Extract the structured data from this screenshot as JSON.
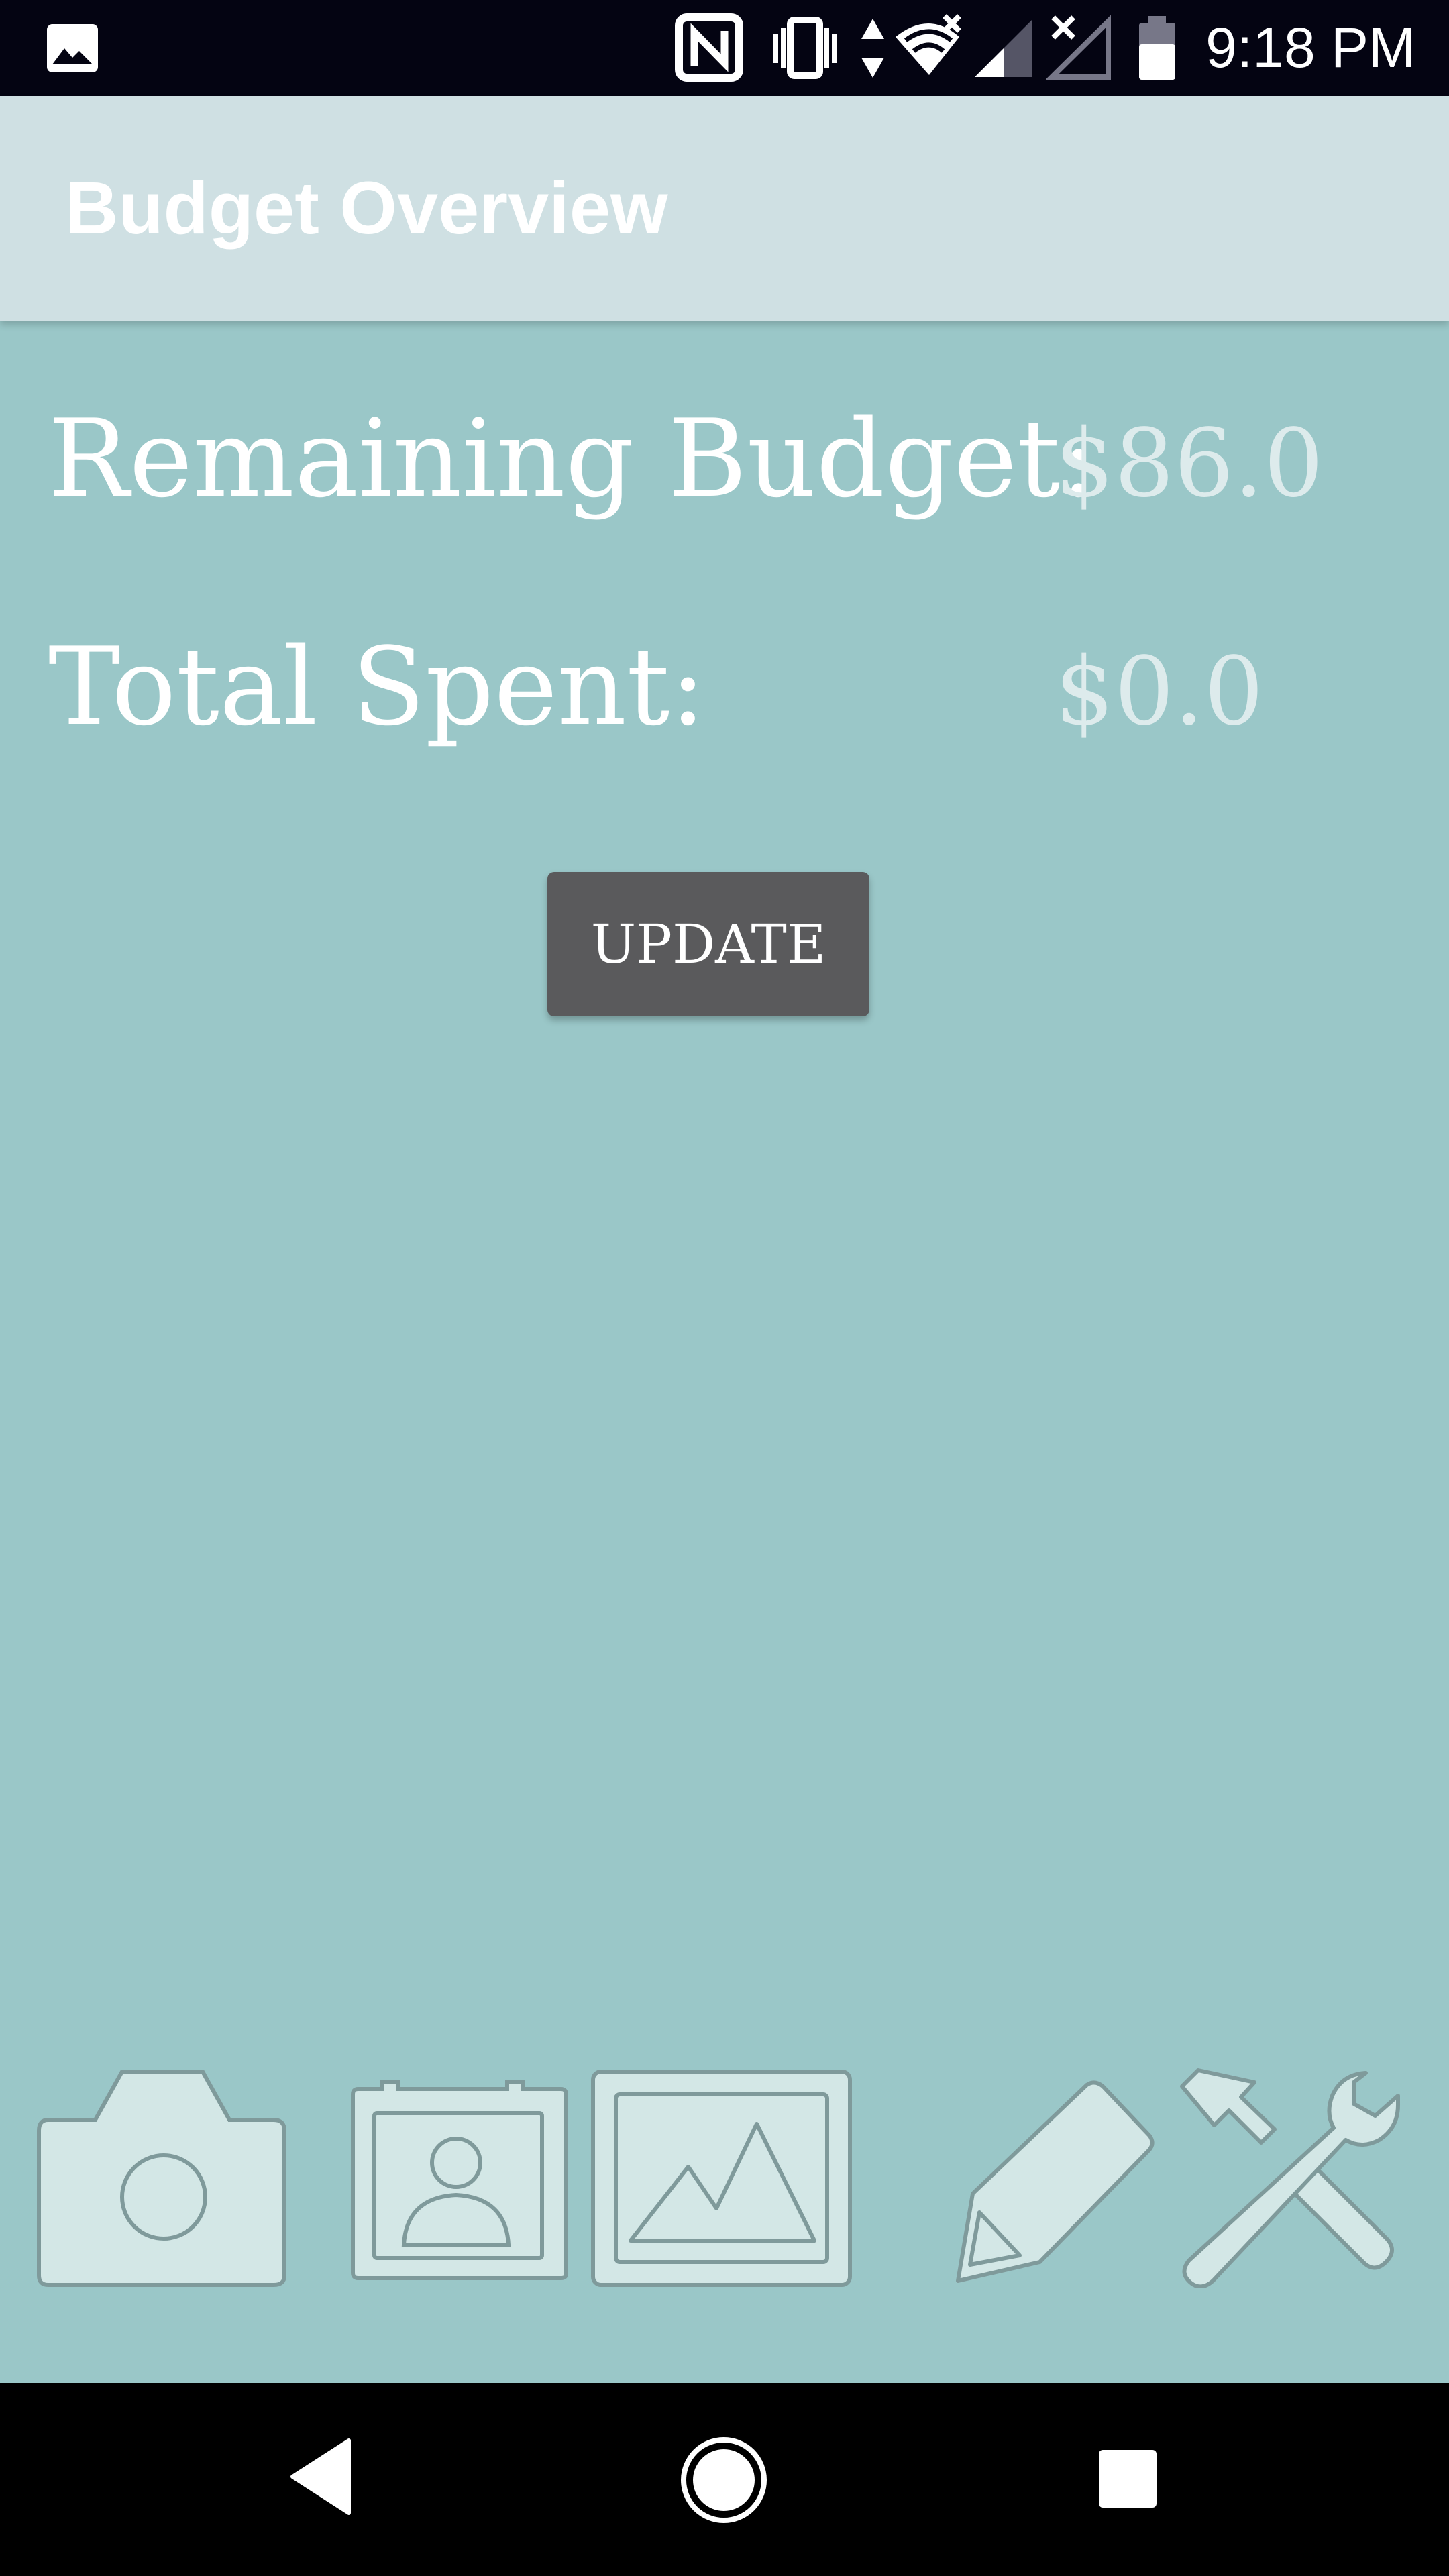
{
  "status_bar": {
    "time": "9:18 PM",
    "icons": [
      "gallery-notification-icon",
      "nfc-icon",
      "vibrate-icon",
      "data-arrows-icon",
      "wifi-icon",
      "cell-signal-icon",
      "no-signal-icon",
      "battery-icon"
    ]
  },
  "app_bar": {
    "title": "Budget Overview",
    "background": "#CFE0E3"
  },
  "budget": {
    "remaining_label": "Remaining Budget:",
    "remaining_value": "$86.0",
    "spent_label": "Total Spent:",
    "spent_value": "$0.0",
    "update_label": "UPDATE"
  },
  "toolbar": {
    "icons": [
      "camera-icon",
      "contact-card-icon",
      "image-gallery-icon",
      "pencil-icon",
      "settings-tools-icon"
    ]
  },
  "nav_bar": {
    "buttons": [
      "back-button",
      "home-button",
      "recents-button"
    ]
  },
  "colors": {
    "background": "#9AC7C8",
    "button": "#5A5A5C",
    "icon_fill": "#D3E7E6",
    "icon_stroke": "#7F9A9B"
  }
}
